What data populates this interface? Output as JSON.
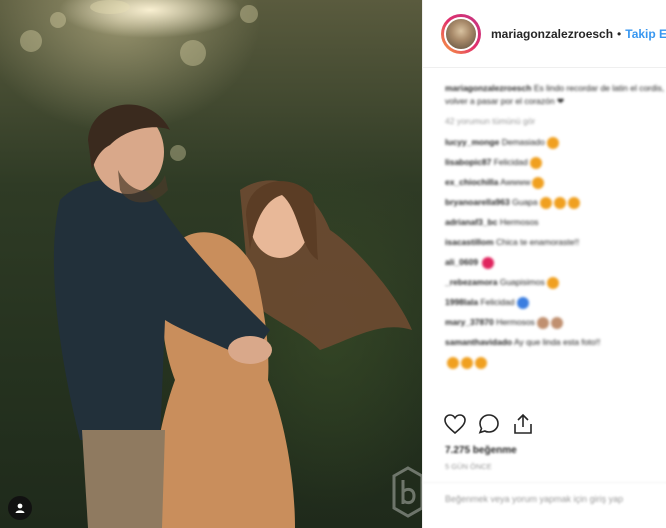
{
  "header": {
    "username": "mariagonzalezroesch",
    "separator": "•",
    "follow_label": "Takip Et"
  },
  "caption": {
    "username": "mariagonzalezroesch",
    "text": "Es lindo recordar de latin el cordis, volver a pasar por el corazón ❤"
  },
  "view_all_comments": "42 yorumun tümünü gör",
  "comments": [
    {
      "user": "lucyy_monge",
      "text": "Demasiado",
      "emoji_color": "#f0a020",
      "emoji_count": 1
    },
    {
      "user": "lisabopic87",
      "text": "Felicidad",
      "emoji_color": "#f0a020",
      "emoji_count": 1
    },
    {
      "user": "ex_chiochilla",
      "text": "Awwww",
      "emoji_color": "#f0a020",
      "emoji_count": 1
    },
    {
      "user": "bryanoarella963",
      "text": "Guapa",
      "emoji_color": "#f0a020",
      "emoji_count": 3
    },
    {
      "user": "adrianaf3_bc",
      "text": "Hermosos",
      "emoji_color": "",
      "emoji_count": 0
    },
    {
      "user": "isacastillom",
      "text": "Chica te enamoraste!!",
      "emoji_color": "",
      "emoji_count": 0
    },
    {
      "user": "ali_0609",
      "text": "",
      "emoji_color": "#e0245e",
      "emoji_count": 1
    },
    {
      "user": "_rebezamora",
      "text": "Guapisimos",
      "emoji_color": "#f0a020",
      "emoji_count": 1
    },
    {
      "user": "1998lala",
      "text": "Felicidad",
      "emoji_color": "#3b7ee0",
      "emoji_count": 1
    },
    {
      "user": "mary_37870",
      "text": "Hermosos",
      "emoji_color": "#c09070",
      "emoji_count": 2
    },
    {
      "user": "samanthavidado",
      "text": "Ay que linda esta foto!!",
      "emoji_color": "",
      "emoji_count": 0
    },
    {
      "user": "",
      "text": "",
      "emoji_color": "#f0a020",
      "emoji_count": 3
    }
  ],
  "actions": {
    "like": "heart-icon",
    "comment": "comment-icon",
    "share": "share-icon"
  },
  "likes_text": "7.275 beğenme",
  "timestamp": "5 Gün Önce",
  "add_comment_placeholder": "Beğenmek veya yorum yapmak için giriş yap"
}
